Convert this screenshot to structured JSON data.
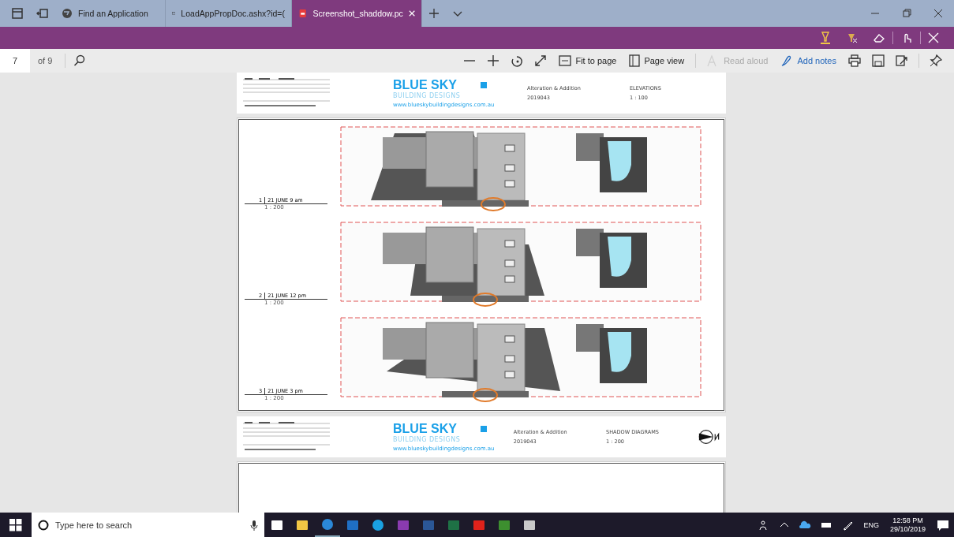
{
  "browser_tabs": [
    {
      "title": "Find an Application",
      "selected": false
    },
    {
      "title": "LoadAppPropDoc.ashx?id=(",
      "selected": false
    },
    {
      "title": "Screenshot_shaddow.pc",
      "selected": true
    }
  ],
  "pdf_toolbar": {
    "page_number": "7",
    "page_count": "of 9",
    "tools": [
      {
        "kind": "zoom-out"
      },
      {
        "kind": "zoom-in"
      },
      {
        "kind": "rotate"
      },
      {
        "kind": "expand"
      },
      {
        "kind": "fit",
        "label": "Fit to page",
        "disabled": false
      },
      {
        "kind": "page-view",
        "label": "Page view",
        "disabled": false
      },
      {
        "kind": "read-aloud",
        "label": "Read aloud",
        "disabled": true
      },
      {
        "kind": "notes",
        "label": "Add notes",
        "disabled": false
      },
      {
        "kind": "print"
      },
      {
        "kind": "save"
      },
      {
        "kind": "share"
      },
      {
        "kind": "pin"
      }
    ]
  },
  "title_blocks": [
    {
      "logo_title": "BLUE SKY",
      "logo_subtitle": "BUILDING DESIGNS",
      "website": "www.blueskybuildingdesigns.com.au",
      "project_title": "Alteration & Addition",
      "project_no": "2019043",
      "sheet_title": "ELEVATIONS",
      "scale": "1 : 100",
      "north_arrow": false
    },
    {
      "logo_title": "BLUE SKY",
      "logo_subtitle": "BUILDING DESIGNS",
      "website": "www.blueskybuildingdesigns.com.au",
      "project_title": "Alteration & Addition",
      "project_no": "2019043",
      "sheet_title": "SHADOW DIAGRAMS",
      "scale": "1 : 200",
      "north_arrow": true
    }
  ],
  "shadow_diagrams": [
    {
      "number": "1",
      "title": "21 JUNE 9 am",
      "scale": "1 : 200"
    },
    {
      "number": "2",
      "title": "21 JUNE 12 pm",
      "scale": "1 : 200"
    },
    {
      "number": "3",
      "title": "21 JUNE 3 pm",
      "scale": "1 : 200"
    }
  ],
  "taskbar": {
    "search_placeholder": "Type here to search",
    "language": "ENG",
    "time": "12:58 PM",
    "date": "29/10/2019"
  }
}
